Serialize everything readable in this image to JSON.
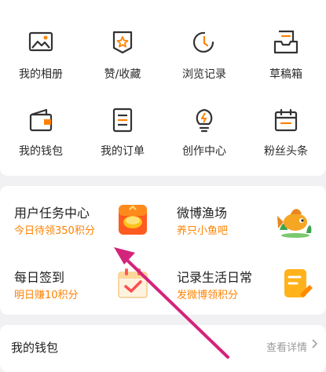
{
  "colors": {
    "accent": "#ff8200",
    "annotation": "#d4237a",
    "icon_stroke": "#333333"
  },
  "grid": {
    "items": [
      {
        "label": "我的相册",
        "icon": "photo-album-icon"
      },
      {
        "label": "赞/收藏",
        "icon": "favorite-badge-icon"
      },
      {
        "label": "浏览记录",
        "icon": "history-clock-icon"
      },
      {
        "label": "草稿箱",
        "icon": "draft-box-icon"
      },
      {
        "label": "我的钱包",
        "icon": "wallet-icon"
      },
      {
        "label": "我的订单",
        "icon": "order-list-icon"
      },
      {
        "label": "创作中心",
        "icon": "creator-bulb-icon"
      },
      {
        "label": "粉丝头条",
        "icon": "calendar-icon"
      }
    ]
  },
  "tasks": {
    "user_task": {
      "title": "用户任务中心",
      "subtitle": "今日待领350积分",
      "icon": "gift-box-icon"
    },
    "fishing": {
      "title": "微博渔场",
      "subtitle": "养只小鱼吧",
      "icon": "goldfish-icon"
    },
    "checkin": {
      "title": "每日签到",
      "subtitle": "明日赚10积分",
      "icon": "checkin-calendar-icon"
    },
    "record": {
      "title": "记录生活日常",
      "subtitle": "发微博领积分",
      "icon": "notepad-icon"
    }
  },
  "wallet": {
    "title": "我的钱包",
    "more": "查看详情"
  }
}
